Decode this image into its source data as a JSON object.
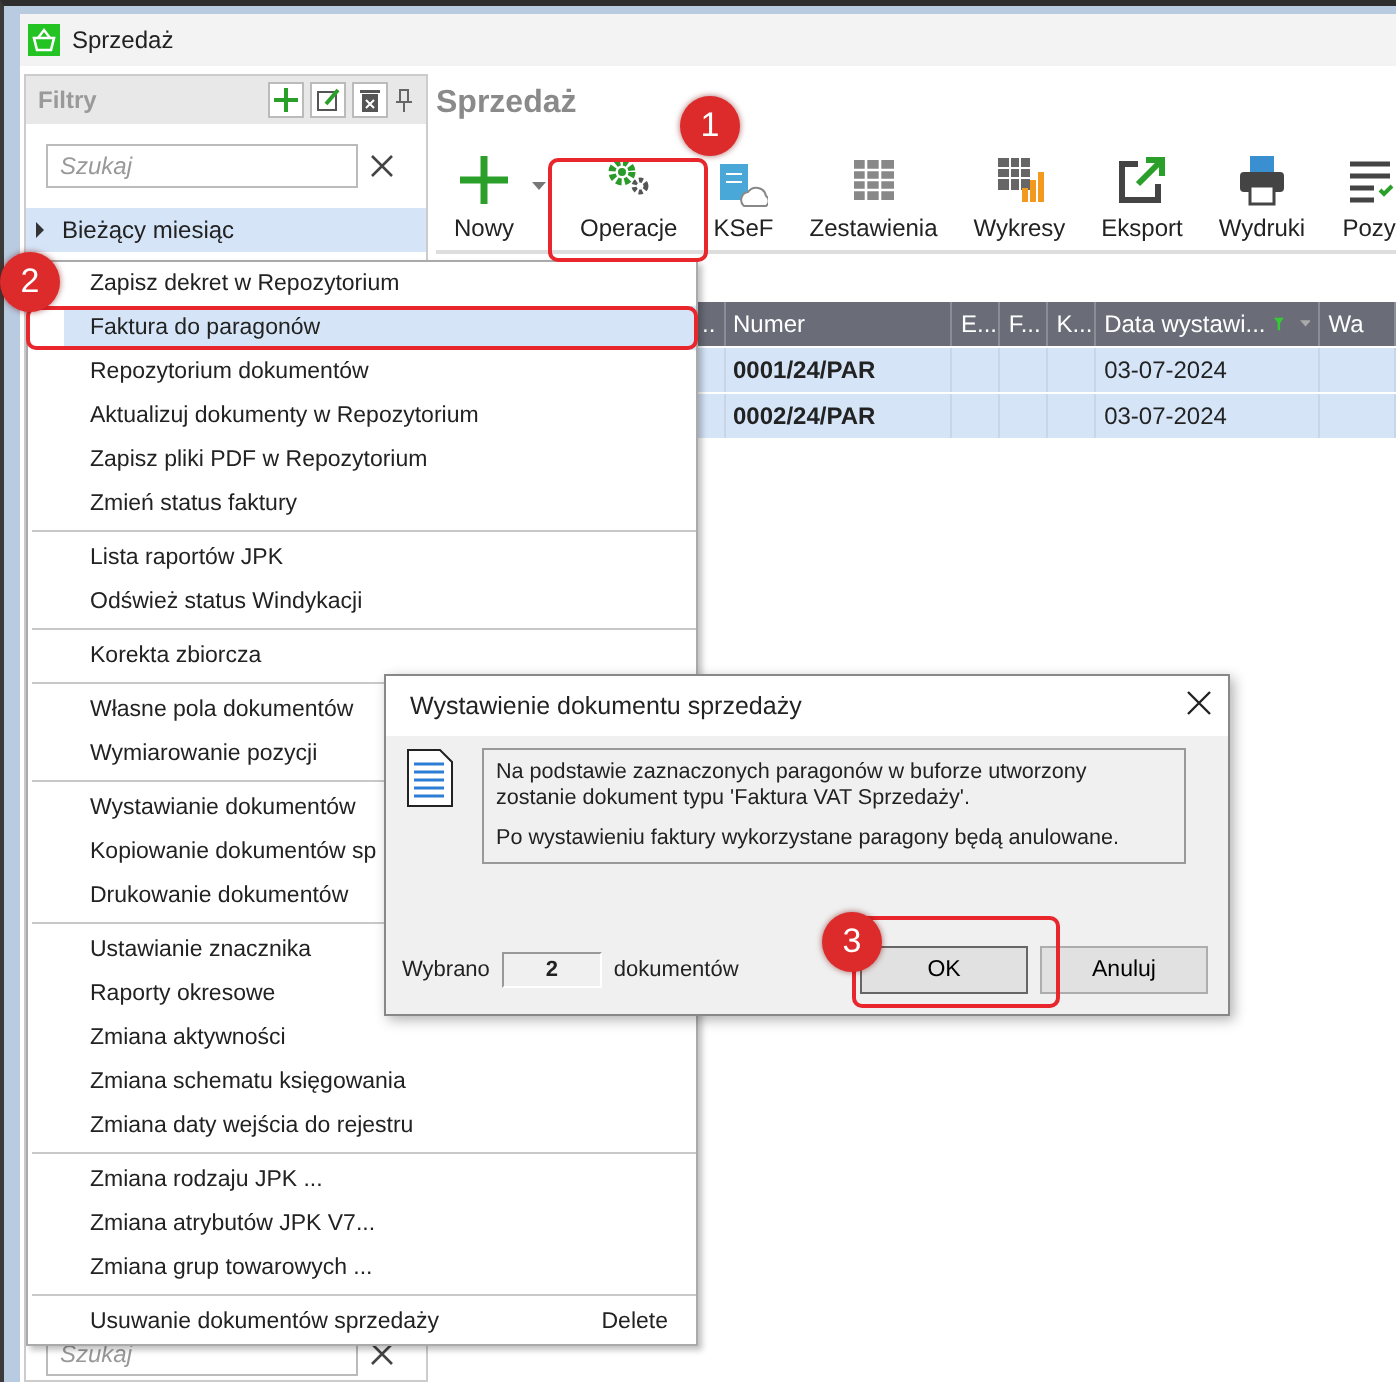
{
  "window": {
    "title": "Sprzedaż"
  },
  "filters": {
    "title": "Filtry",
    "search": {
      "placeholder": "Szukaj"
    },
    "tree": [
      {
        "label": "Bieżący miesiąc",
        "expanded": false,
        "selected": true
      }
    ],
    "bottom_search": {
      "placeholder": "Szukaj"
    }
  },
  "header": {
    "title": "Sprzedaż"
  },
  "toolbar": [
    {
      "label": "Nowy",
      "kind": "plus",
      "dropdown": true
    },
    {
      "label": "Operacje",
      "kind": "gears",
      "dropdown": false
    },
    {
      "label": "KSeF",
      "kind": "cloud",
      "dropdown": false
    },
    {
      "label": "Zestawienia",
      "kind": "grid",
      "dropdown": false
    },
    {
      "label": "Wykresy",
      "kind": "chart",
      "dropdown": false
    },
    {
      "label": "Eksport",
      "kind": "export",
      "dropdown": false
    },
    {
      "label": "Wydruki",
      "kind": "printer",
      "dropdown": false
    },
    {
      "label": "Pozy",
      "kind": "list",
      "dropdown": false
    }
  ],
  "table": {
    "columns": [
      {
        "label": "..",
        "filtered": false
      },
      {
        "label": "Numer",
        "filtered": false
      },
      {
        "label": "E...",
        "filtered": false
      },
      {
        "label": "F...",
        "filtered": false
      },
      {
        "label": "K...",
        "filtered": false
      },
      {
        "label": "Data wystawi...",
        "filtered": true
      },
      {
        "label": "Wa",
        "filtered": false
      }
    ],
    "rows": [
      {
        "selected": true,
        "cells": [
          "",
          "0001/24/PAR",
          "",
          "",
          "",
          "03-07-2024",
          ""
        ]
      },
      {
        "selected": true,
        "cells": [
          "",
          "0002/24/PAR",
          "",
          "",
          "",
          "03-07-2024",
          ""
        ]
      }
    ]
  },
  "context_menu": [
    {
      "kind": "item",
      "label": "Zapisz dekret w Repozytorium",
      "selected": false
    },
    {
      "kind": "item",
      "label": "Faktura do paragonów",
      "selected": true
    },
    {
      "kind": "item",
      "label": "Repozytorium dokumentów",
      "selected": false
    },
    {
      "kind": "item",
      "label": "Aktualizuj dokumenty w Repozytorium",
      "selected": false
    },
    {
      "kind": "item",
      "label": "Zapisz pliki PDF w Repozytorium",
      "selected": false
    },
    {
      "kind": "item",
      "label": "Zmień status faktury",
      "selected": false
    },
    {
      "kind": "separator"
    },
    {
      "kind": "item",
      "label": "Lista raportów JPK",
      "selected": false
    },
    {
      "kind": "item",
      "label": "Odśwież status Windykacji",
      "selected": false
    },
    {
      "kind": "separator"
    },
    {
      "kind": "item",
      "label": "Korekta zbiorcza",
      "selected": false
    },
    {
      "kind": "separator"
    },
    {
      "kind": "item",
      "label": "Własne pola dokumentów",
      "selected": false
    },
    {
      "kind": "item",
      "label": "Wymiarowanie pozycji",
      "selected": false
    },
    {
      "kind": "separator"
    },
    {
      "kind": "item",
      "label": "Wystawianie dokumentów",
      "selected": false
    },
    {
      "kind": "item",
      "label": "Kopiowanie dokumentów sp",
      "selected": false
    },
    {
      "kind": "item",
      "label": "Drukowanie dokumentów",
      "selected": false
    },
    {
      "kind": "separator"
    },
    {
      "kind": "item",
      "label": "Ustawianie znacznika",
      "selected": false
    },
    {
      "kind": "item",
      "label": "Raporty okresowe",
      "selected": false
    },
    {
      "kind": "item",
      "label": "Zmiana aktywności",
      "selected": false
    },
    {
      "kind": "item",
      "label": "Zmiana schematu księgowania",
      "selected": false
    },
    {
      "kind": "item",
      "label": "Zmiana daty wejścia do rejestru",
      "selected": false
    },
    {
      "kind": "separator"
    },
    {
      "kind": "item",
      "label": "Zmiana rodzaju JPK ...",
      "selected": false
    },
    {
      "kind": "item",
      "label": "Zmiana atrybutów JPK V7...",
      "selected": false
    },
    {
      "kind": "item",
      "label": "Zmiana grup towarowych ...",
      "selected": false
    },
    {
      "kind": "separator"
    },
    {
      "kind": "item",
      "label": "Usuwanie dokumentów sprzedaży",
      "shortcut": "Delete",
      "selected": false
    }
  ],
  "dialog": {
    "title": "Wystawienie dokumentu sprzedaży",
    "messages": [
      "Na podstawie zaznaczonych paragonów w buforze utworzony zostanie dokument typu 'Faktura VAT Sprzedaży'.",
      "Po wystawieniu faktury wykorzystane paragony będą anulowane."
    ],
    "count_label": "Wybrano",
    "count": "2",
    "count_suffix": "dokumentów",
    "buttons": [
      {
        "label": "OK",
        "focused": true
      },
      {
        "label": "Anuluj",
        "focused": false
      }
    ]
  },
  "annotations": [
    {
      "label": "1"
    },
    {
      "label": "2"
    },
    {
      "label": "3"
    }
  ]
}
